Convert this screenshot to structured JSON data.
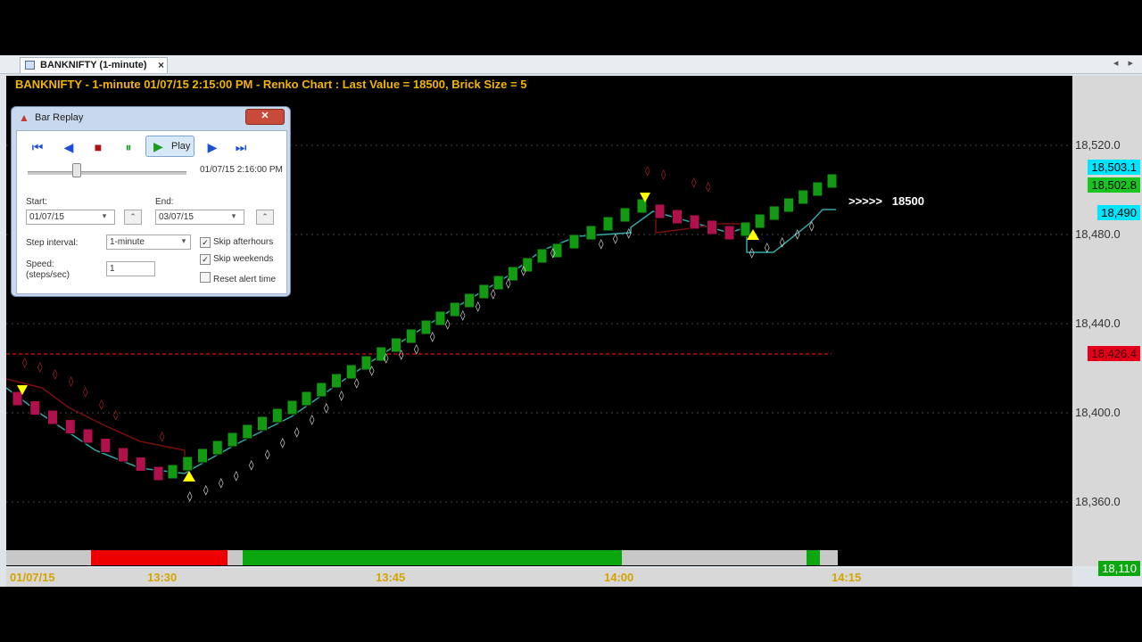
{
  "window": {
    "tab_label": "BANKNIFTY (1-minute)",
    "tab_close": "×",
    "tab_nav": "◂ ▸"
  },
  "chart": {
    "title": "BANKNIFTY - 1-minute 01/07/15 2:15:00 PM - Renko Chart : Last Value = 18500, Brick Size = 5",
    "annotation": ">>>>>   18500",
    "price_ticks": [
      "18,520.0",
      "18,480.0",
      "18,440.0",
      "18,400.0",
      "18,360.0"
    ],
    "badges": [
      {
        "text": "18,503.1",
        "bg": "#00e5ff",
        "fg": "#000000"
      },
      {
        "text": "18,502.8",
        "bg": "#19c51e",
        "fg": "#000000"
      },
      {
        "text": "18,490",
        "bg": "#00e5ff",
        "fg": "#000000"
      },
      {
        "text": "18,426.4",
        "bg": "#e4001b",
        "fg": "#3a0000"
      },
      {
        "text": "18,110",
        "bg": "#0aa70f",
        "fg": "#ffffff"
      }
    ],
    "time_labels": [
      "01/07/15",
      "13:30",
      "13:45",
      "14:00",
      "14:15"
    ],
    "colors": {
      "up": "#129a12",
      "down": "#b0104c",
      "stop": "#33a8a6",
      "upper": "#7a0f0f",
      "ref_line": "#8a0a0a",
      "buy_arrow": "#ffff00",
      "sell_arrow": "#ffff00"
    }
  },
  "dialog": {
    "title": "Bar Replay",
    "close": "✕",
    "toolbar": {
      "first": "⏮",
      "prev": "◀",
      "stop": "■",
      "pause": "⏸",
      "play_icon": "▶",
      "play": "Play",
      "next": "▶",
      "last": "⏭"
    },
    "current_datetime": "01/07/15 2:16:00 PM",
    "start_label": "Start:",
    "start_value": "01/07/15",
    "end_label": "End:",
    "end_value": "03/07/15",
    "step_label": "Step interval:",
    "step_value": "1-minute",
    "speed_label": "Speed: (steps/sec)",
    "speed_value": "1",
    "skip_afterhours": "Skip afterhours",
    "skip_weekends": "Skip weekends",
    "reset_alert": "Reset alert time"
  }
}
